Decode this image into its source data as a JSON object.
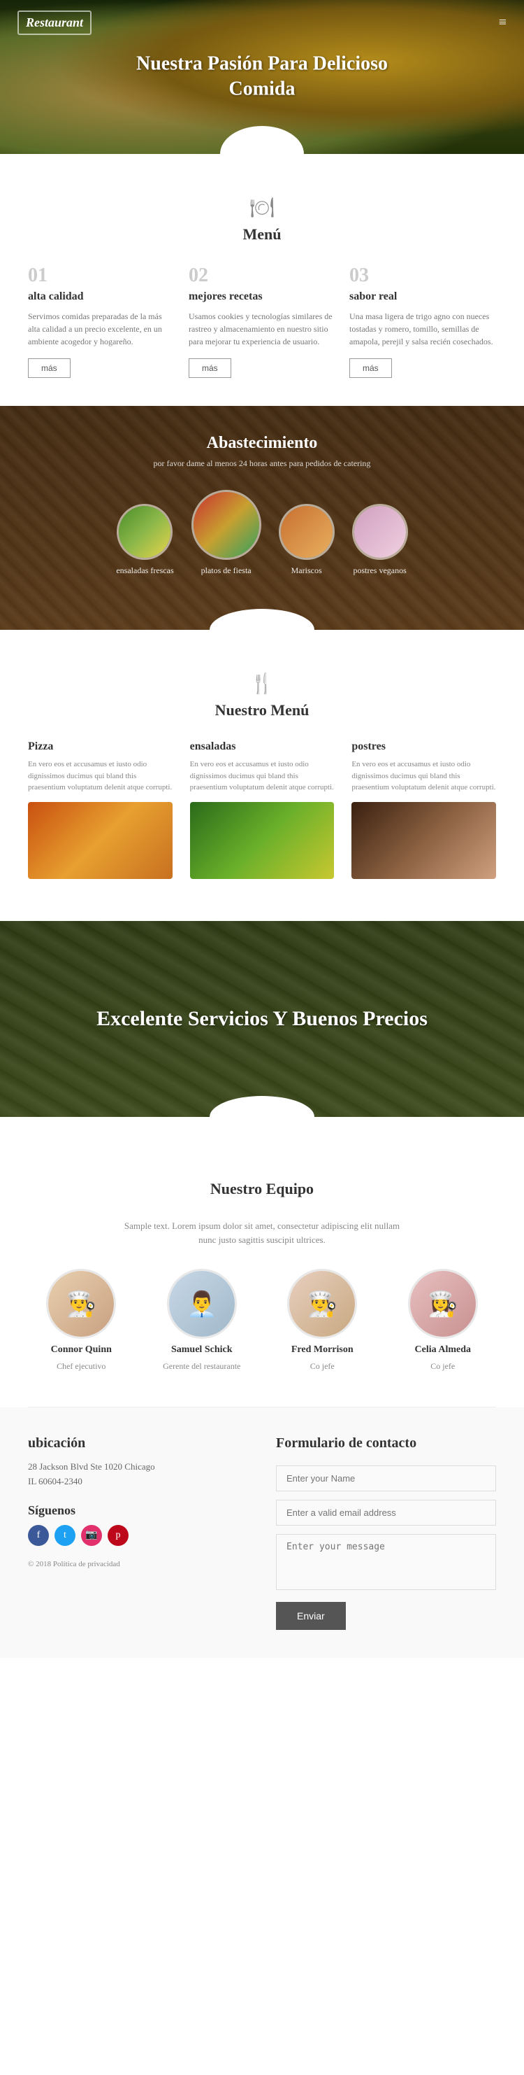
{
  "site": {
    "logo": "Restaurant",
    "logo_letter": "R"
  },
  "hero": {
    "title": "Nuestra Pasión Para Delicioso Comida"
  },
  "menu_section": {
    "icon": "🍽",
    "title": "Menú",
    "items": [
      {
        "number": "01",
        "title": "alta calidad",
        "text": "Servimos comidas preparadas de la más alta calidad a un precio excelente, en un ambiente acogedor y hogareño.",
        "btn": "más"
      },
      {
        "number": "02",
        "title": "mejores recetas",
        "text": "Usamos cookies y tecnologías similares de rastreo y almacenamiento en nuestro sitio para mejorar tu experiencia de usuario.",
        "btn": "más"
      },
      {
        "number": "03",
        "title": "sabor real",
        "text": "Una masa ligera de trigo agno con nueces tostadas y romero, tomillo, semillas de amapola, perejil y salsa recién cosechados.",
        "btn": "más"
      }
    ]
  },
  "catering": {
    "title": "Abastecimiento",
    "subtitle": "por favor dame al menos 24 horas antes para pedidos de catering",
    "items": [
      {
        "label": "ensaladas frescas"
      },
      {
        "label": "platos de fiesta"
      },
      {
        "label": "Mariscos"
      },
      {
        "label": "postres veganos"
      }
    ]
  },
  "nuestro_menu": {
    "icon": "🍴",
    "title": "Nuestro Menú",
    "items": [
      {
        "title": "Pizza",
        "text": "En vero eos et accusamus et iusto odio dignissimos ducimus qui bland this praesentium voluptatum delenit atque corrupti."
      },
      {
        "title": "ensaladas",
        "text": "En vero eos et accusamus et iusto odio dignissimos ducimus qui bland this praesentium voluptatum delenit atque corrupti."
      },
      {
        "title": "postres",
        "text": "En vero eos et accusamus et iusto odio dignissimos ducimus qui bland this praesentium voluptatum delenit atque corrupti."
      }
    ]
  },
  "excellent": {
    "text": "Excelente Servicios Y Buenos Precios"
  },
  "team": {
    "title": "Nuestro Equipo",
    "subtitle": "Sample text. Lorem ipsum dolor sit amet, consectetur adipiscing elit nullam nunc justo sagittis suscipit ultrices.",
    "members": [
      {
        "name": "Connor Quinn",
        "role": "Chef ejecutivo"
      },
      {
        "name": "Samuel Schick",
        "role": "Gerente del restaurante"
      },
      {
        "name": "Fred Morrison",
        "role": "Co jefe"
      },
      {
        "name": "Celia Almeda",
        "role": "Co jefe"
      }
    ]
  },
  "location": {
    "title": "ubicación",
    "address": "28 Jackson Blvd Ste 1020 Chicago",
    "city": "IL 60604-2340"
  },
  "siguenos": {
    "title": "Síguenos"
  },
  "copyright": {
    "text": "© 2018 Política de privacidad"
  },
  "contact": {
    "title": "Formulario de contacto",
    "fields": {
      "name_placeholder": "Enter your Name",
      "email_placeholder": "Enter a valid email address",
      "message_placeholder": "Enter your message"
    },
    "submit": "Enviar"
  }
}
